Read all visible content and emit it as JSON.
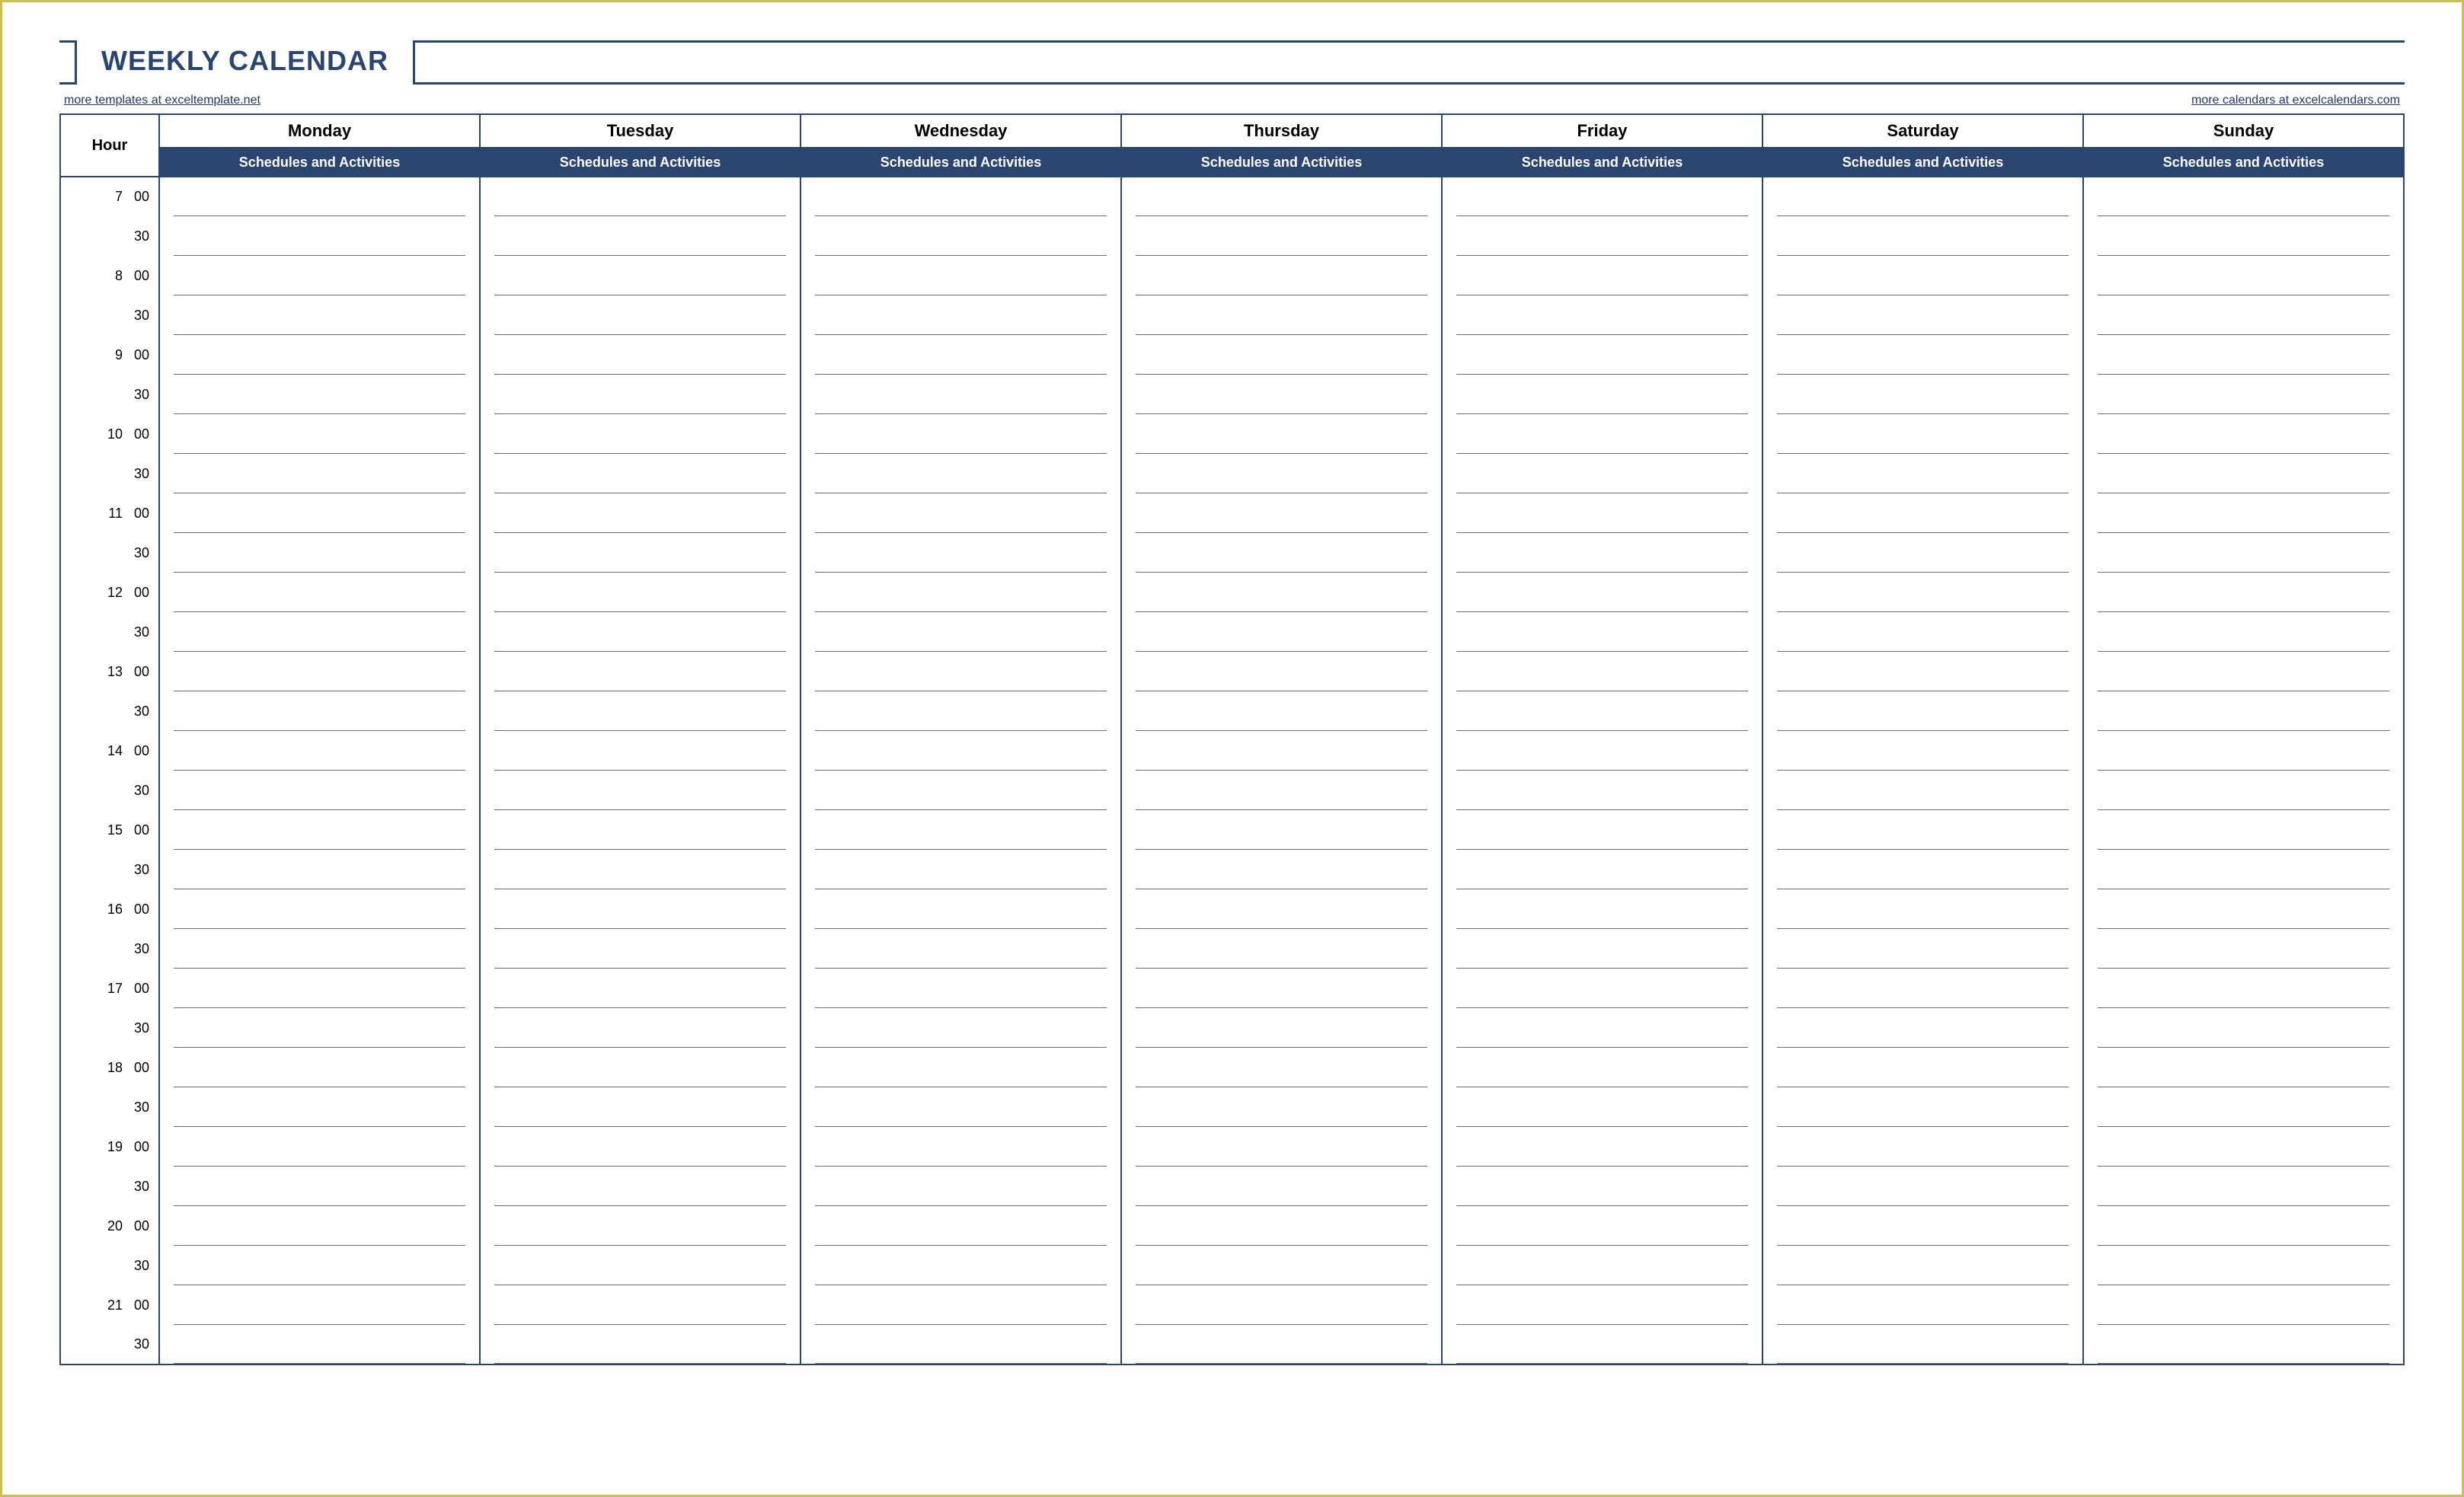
{
  "title": "WEEKLY CALENDAR",
  "links": {
    "left": "more templates at exceltemplate.net",
    "right": "more calendars at excelcalendars.com"
  },
  "hour_header": "Hour",
  "subheader": "Schedules and Activities",
  "days": [
    "Monday",
    "Tuesday",
    "Wednesday",
    "Thursday",
    "Friday",
    "Saturday",
    "Sunday"
  ],
  "rows": [
    {
      "h": "7",
      "m": "00"
    },
    {
      "h": "",
      "m": "30"
    },
    {
      "h": "8",
      "m": "00"
    },
    {
      "h": "",
      "m": "30"
    },
    {
      "h": "9",
      "m": "00"
    },
    {
      "h": "",
      "m": "30"
    },
    {
      "h": "10",
      "m": "00"
    },
    {
      "h": "",
      "m": "30"
    },
    {
      "h": "11",
      "m": "00"
    },
    {
      "h": "",
      "m": "30"
    },
    {
      "h": "12",
      "m": "00"
    },
    {
      "h": "",
      "m": "30"
    },
    {
      "h": "13",
      "m": "00"
    },
    {
      "h": "",
      "m": "30"
    },
    {
      "h": "14",
      "m": "00"
    },
    {
      "h": "",
      "m": "30"
    },
    {
      "h": "15",
      "m": "00"
    },
    {
      "h": "",
      "m": "30"
    },
    {
      "h": "16",
      "m": "00"
    },
    {
      "h": "",
      "m": "30"
    },
    {
      "h": "17",
      "m": "00"
    },
    {
      "h": "",
      "m": "30"
    },
    {
      "h": "18",
      "m": "00"
    },
    {
      "h": "",
      "m": "30"
    },
    {
      "h": "19",
      "m": "00"
    },
    {
      "h": "",
      "m": "30"
    },
    {
      "h": "20",
      "m": "00"
    },
    {
      "h": "",
      "m": "30"
    },
    {
      "h": "21",
      "m": "00"
    },
    {
      "h": "",
      "m": "30"
    }
  ]
}
